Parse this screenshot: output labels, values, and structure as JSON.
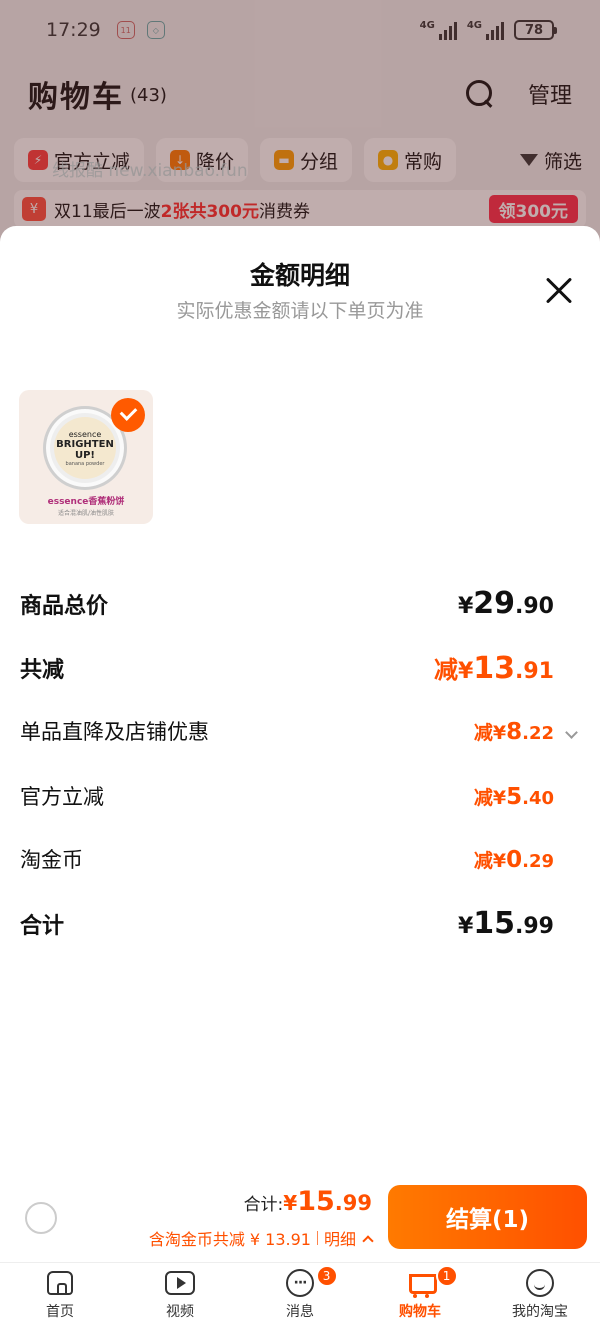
{
  "status_bar": {
    "time": "17:29",
    "network_1": "4G",
    "network_2": "4G",
    "battery": "78"
  },
  "cart": {
    "title": "购物车",
    "count": "(43)",
    "manage": "管理"
  },
  "chips": [
    {
      "label": "官方立减",
      "icon": "lightning-icon",
      "color": "#ff3b3b"
    },
    {
      "label": "降价",
      "icon": "price-down-icon",
      "color": "#ff7a00"
    },
    {
      "label": "分组",
      "icon": "folder-icon",
      "color": "#ff9f00"
    },
    {
      "label": "常购",
      "icon": "bag-icon",
      "color": "#ffb300"
    },
    {
      "label": "筛选",
      "icon": "filter-icon"
    }
  ],
  "promo": {
    "prefix": "双11最后一波",
    "highlight": "2张共300元",
    "suffix": "消费券",
    "button": "领300元"
  },
  "watermark": "线报酷 new.xianbao.fun",
  "sheet": {
    "title": "金额明细",
    "subtitle": "实际优惠金额请以下单页为准",
    "product": {
      "brand": "essence",
      "name_line1": "BRIGHTEN",
      "name_line2": "UP!",
      "type": "banana powder",
      "caption": "essence香蕉粉饼",
      "note": "适合混油肌/油性肌肤"
    },
    "rows": {
      "subtotal": {
        "label": "商品总价",
        "currency": "¥",
        "int": "29",
        "dec": ".90"
      },
      "discount_total": {
        "label": "共减",
        "prefix": "减",
        "currency": "¥",
        "int": "13",
        "dec": ".91"
      },
      "store_discount": {
        "label": "单品直降及店铺优惠",
        "prefix": "减",
        "currency": "¥",
        "int": "8",
        "dec": ".22"
      },
      "official_discount": {
        "label": "官方立减",
        "prefix": "减",
        "currency": "¥",
        "int": "5",
        "dec": ".40"
      },
      "coins": {
        "label": "淘金币",
        "prefix": "减",
        "currency": "¥",
        "int": "0",
        "dec": ".29"
      },
      "total": {
        "label": "合计",
        "currency": "¥",
        "int": "15",
        "dec": ".99"
      }
    }
  },
  "checkout": {
    "total_label": "合计:",
    "currency": "¥",
    "int": "15",
    "dec": ".99",
    "discount_text": "含淘金币共减 ¥ 13.91",
    "detail_link": "明细",
    "pay_button": "结算(1)"
  },
  "tabs": [
    {
      "label": "首页",
      "icon": "home-icon"
    },
    {
      "label": "视频",
      "icon": "video-icon"
    },
    {
      "label": "消息",
      "icon": "message-icon",
      "badge": "3"
    },
    {
      "label": "购物车",
      "icon": "cart-icon",
      "badge": "1",
      "active": true
    },
    {
      "label": "我的淘宝",
      "icon": "profile-icon"
    }
  ],
  "colors": {
    "accent": "#ff5000",
    "promo_red": "#ff2a4a"
  }
}
